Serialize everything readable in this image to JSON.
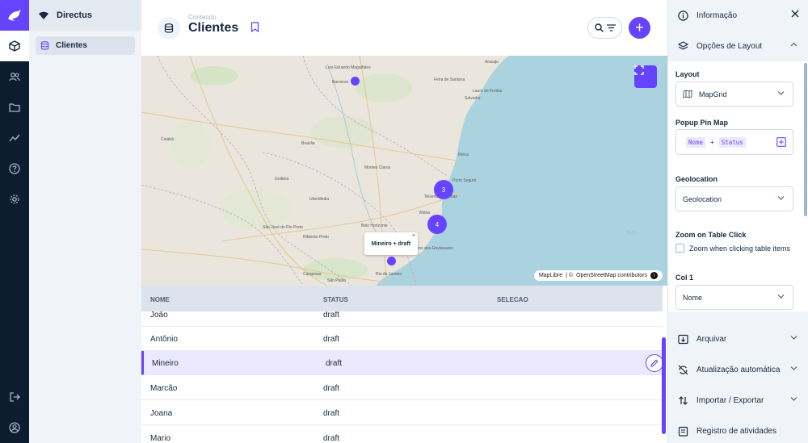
{
  "project": {
    "name": "Directus"
  },
  "navigation": {
    "items": [
      {
        "label": "Clientes"
      }
    ]
  },
  "header": {
    "breadcrumb": "Conteúdo",
    "title": "Clientes"
  },
  "map": {
    "labels": [
      "Luís Eduardo Magalhães",
      "Barreiras",
      "Feira de Santana",
      "Salvador",
      "Lauro de Freitas",
      "Aracaju",
      "Cuiabá",
      "Brasília",
      "Goiânia",
      "Montes Claros",
      "Uberlândia",
      "Belo Horizonte",
      "São José do Rio Preto",
      "Ribeirão Preto",
      "Campinas",
      "São Paulo",
      "Rio de Janeiro",
      "Vitória",
      "Ilhéus",
      "Porto Seguro",
      "Campos dos Goytacazes",
      "Teixeira de Freitas"
    ],
    "clusters": [
      {
        "count": "3"
      },
      {
        "count": "4"
      }
    ],
    "popup": {
      "text": "Mineiro + draft",
      "close": "×"
    },
    "attribution": {
      "maplibre": "MapLibre",
      "separator": " | © ",
      "osm": "OpenStreetMap contributors"
    },
    "info": "i"
  },
  "table": {
    "columns": [
      "NOME",
      "STATUS",
      "SELECAO"
    ],
    "rows": [
      {
        "nome": "João",
        "status": "draft"
      },
      {
        "nome": "Antônio",
        "status": "draft"
      },
      {
        "nome": "Mineiro",
        "status": "draft"
      },
      {
        "nome": "Marcão",
        "status": "draft"
      },
      {
        "nome": "Joana",
        "status": "draft"
      },
      {
        "nome": "Mario",
        "status": "draft"
      }
    ]
  },
  "sidebar": {
    "info": "Informação",
    "layout_options": "Opções de Layout",
    "layout_label": "Layout",
    "layout_value": "MapGrid",
    "popup_label": "Popup Pin Map",
    "popup_field1": "Nome",
    "popup_plus": "+",
    "popup_field2": "Status",
    "geolocation_label": "Geolocation",
    "geolocation_value": "Geolocation",
    "zoom_label": "Zoom on Table Click",
    "zoom_checkbox": "Zoom when clicking table items",
    "col1_label": "Col 1",
    "col1_value": "Nome",
    "archive": "Arquivar",
    "auto_refresh": "Atualização automática",
    "import_export": "Importar / Exportar",
    "activity": "Registro de atividades"
  }
}
